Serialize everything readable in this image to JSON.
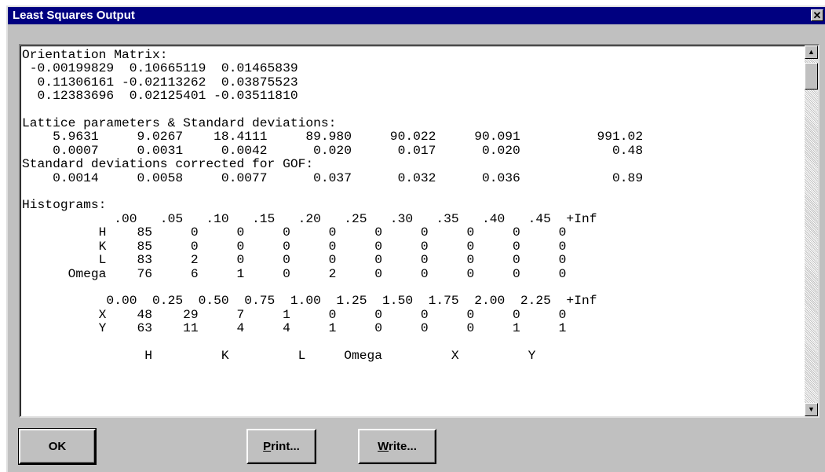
{
  "window": {
    "title": "Least Squares Output",
    "close_glyph": "✕"
  },
  "output": {
    "orientation": {
      "heading": "Orientation Matrix:",
      "rows": [
        [
          "-0.00199829",
          "0.10665119",
          "0.01465839"
        ],
        [
          "0.11306161",
          "-0.02113262",
          "0.03875523"
        ],
        [
          "0.12383696",
          "0.02125401",
          "-0.03511810"
        ]
      ]
    },
    "lattice": {
      "heading": "Lattice parameters & Standard deviations:",
      "values": [
        "5.9631",
        "9.0267",
        "18.4111",
        "89.980",
        "90.022",
        "90.091",
        "991.02"
      ],
      "std": [
        "0.0007",
        "0.0031",
        "0.0042",
        "0.020",
        "0.017",
        "0.020",
        "0.48"
      ],
      "gof_heading": "Standard deviations corrected for GOF:",
      "gof_std": [
        "0.0014",
        "0.0058",
        "0.0077",
        "0.037",
        "0.032",
        "0.036",
        "0.89"
      ]
    },
    "histograms": {
      "heading": "Histograms:",
      "table1": {
        "bins": [
          ".00",
          ".05",
          ".10",
          ".15",
          ".20",
          ".25",
          ".30",
          ".35",
          ".40",
          ".45",
          "+Inf"
        ],
        "rows": [
          {
            "label": "H",
            "values": [
              "85",
              "0",
              "0",
              "0",
              "0",
              "0",
              "0",
              "0",
              "0",
              "0"
            ]
          },
          {
            "label": "K",
            "values": [
              "85",
              "0",
              "0",
              "0",
              "0",
              "0",
              "0",
              "0",
              "0",
              "0"
            ]
          },
          {
            "label": "L",
            "values": [
              "83",
              "2",
              "0",
              "0",
              "0",
              "0",
              "0",
              "0",
              "0",
              "0"
            ]
          },
          {
            "label": "Omega",
            "values": [
              "76",
              "6",
              "1",
              "0",
              "2",
              "0",
              "0",
              "0",
              "0",
              "0"
            ]
          }
        ]
      },
      "table2": {
        "bins": [
          "0.00",
          "0.25",
          "0.50",
          "0.75",
          "1.00",
          "1.25",
          "1.50",
          "1.75",
          "2.00",
          "2.25",
          "+Inf"
        ],
        "rows": [
          {
            "label": "X",
            "values": [
              "48",
              "29",
              "7",
              "1",
              "0",
              "0",
              "0",
              "0",
              "0",
              "0"
            ]
          },
          {
            "label": "Y",
            "values": [
              "63",
              "11",
              "4",
              "4",
              "1",
              "0",
              "0",
              "0",
              "1",
              "1"
            ]
          }
        ]
      },
      "footer_labels": [
        "H",
        "K",
        "L",
        "Omega",
        "X",
        "Y"
      ]
    }
  },
  "scrollbar": {
    "up_glyph": "▲",
    "down_glyph": "▼"
  },
  "buttons": {
    "ok": "OK",
    "print": {
      "mnemonic": "P",
      "rest": "rint..."
    },
    "write": {
      "mnemonic": "W",
      "rest": "rite..."
    }
  }
}
